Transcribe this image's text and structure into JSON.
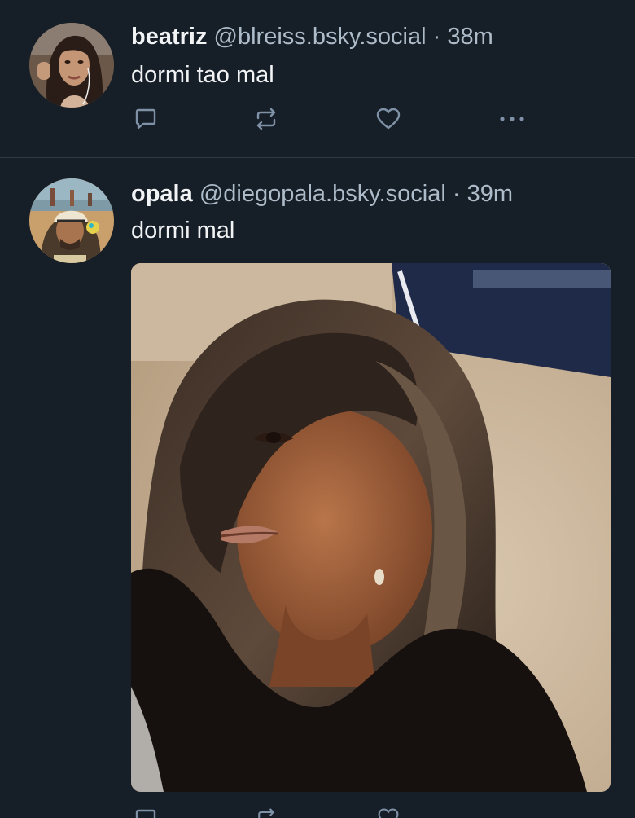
{
  "posts": [
    {
      "display_name": "beatriz",
      "handle": "@blreiss.bsky.social",
      "separator": "·",
      "time": "38m",
      "text": "dormi tao mal",
      "avatar_icon": "profile-photo"
    },
    {
      "display_name": "opala",
      "handle": "@diegopala.bsky.social",
      "separator": "·",
      "time": "39m",
      "text": "dormi mal",
      "avatar_icon": "profile-photo",
      "image": "photo-of-woman-with-long-layered-hair"
    }
  ],
  "actions": [
    "reply-icon",
    "repost-icon",
    "like-icon",
    "more-icon"
  ],
  "colors": {
    "background": "#161e27",
    "divider": "#2e3947",
    "text_primary": "#f1f3f5",
    "text_secondary": "#aebbc9",
    "icon": "#7f91a6"
  }
}
